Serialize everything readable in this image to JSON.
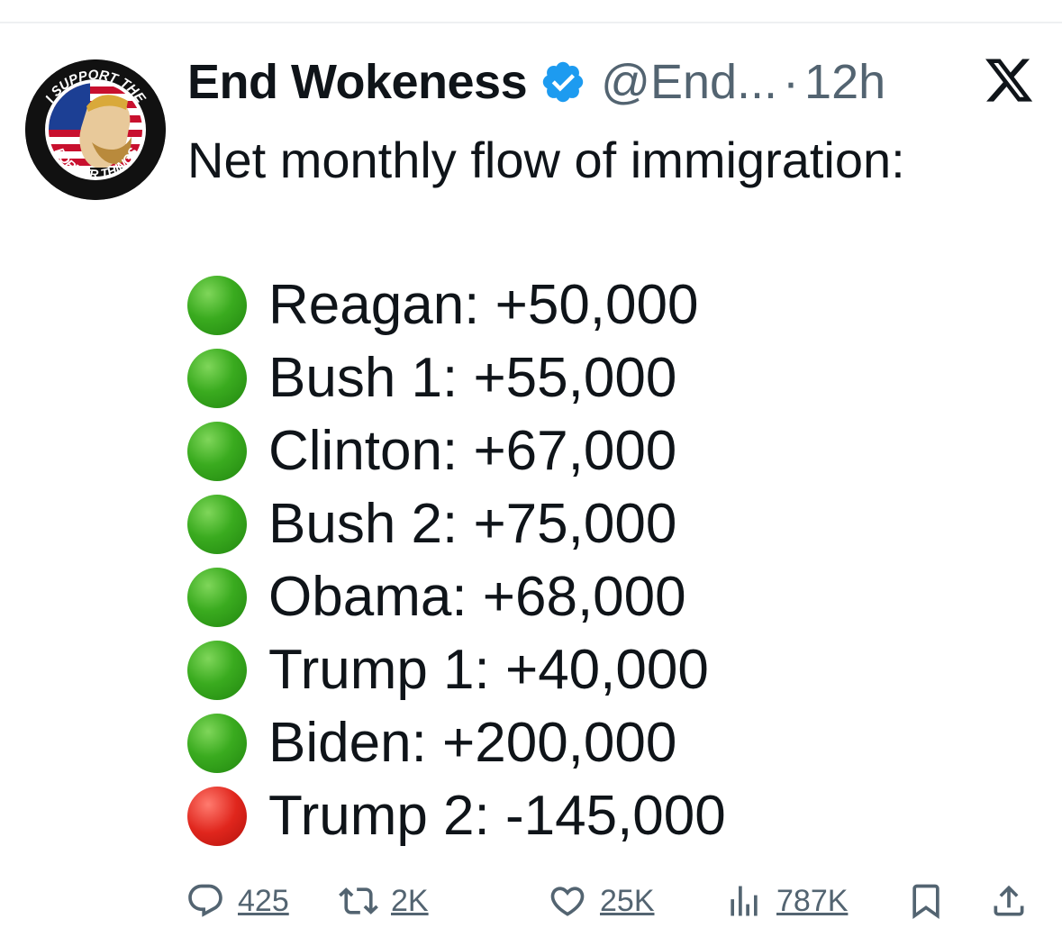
{
  "author": {
    "display_name": "End Wokeness",
    "handle": "@End...",
    "separator": "·",
    "timestamp": "12h",
    "verified": true,
    "avatar_text_top": "I SUPPORT THE",
    "avatar_text_bottom": "FORMER THINGS"
  },
  "tweet": {
    "heading": "Net monthly flow of immigration:",
    "items": [
      {
        "text": "Reagan: +50,000",
        "status": "green"
      },
      {
        "text": "Bush 1: +55,000",
        "status": "green"
      },
      {
        "text": "Clinton: +67,000",
        "status": "green"
      },
      {
        "text": "Bush 2: +75,000",
        "status": "green"
      },
      {
        "text": "Obama: +68,000",
        "status": "green"
      },
      {
        "text": "Trump 1: +40,000",
        "status": "green"
      },
      {
        "text": "Biden: +200,000",
        "status": "green"
      },
      {
        "text": "Trump 2: -145,000",
        "status": "red"
      }
    ]
  },
  "actions": {
    "replies": "425",
    "reposts": "2K",
    "likes": "25K",
    "views": "787K"
  },
  "icons": {
    "verified": "verified-badge-icon",
    "platform": "x-logo-icon",
    "reply": "reply-icon",
    "repost": "repost-icon",
    "like": "heart-icon",
    "views": "views-icon",
    "bookmark": "bookmark-icon",
    "share": "share-icon"
  },
  "colors": {
    "verified_blue": "#1d9bf0",
    "text_primary": "#0f1419",
    "text_secondary": "#536471",
    "green_circle": "#3aab1f",
    "red_circle": "#e0261d"
  }
}
